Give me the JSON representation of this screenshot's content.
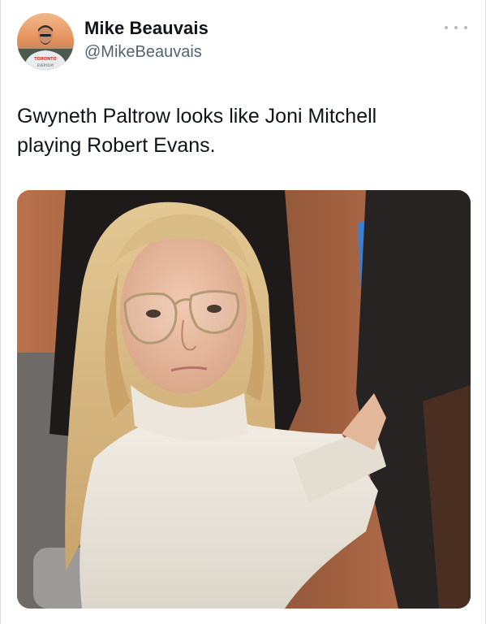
{
  "tweet": {
    "author": {
      "display_name": "Mike Beauvais",
      "handle": "@MikeBeauvais",
      "avatar": {
        "icon": "profile-photo",
        "shirt_text": "TORONTO",
        "shirt_text_2": "EVERYDAY"
      }
    },
    "more_icon": "more-horizontal-icon",
    "text_line_1": "Gwyneth Paltrow looks like Joni Mitchell",
    "text_line_2": "playing Robert Evans.",
    "media": {
      "kind": "photo",
      "description_icon": "photo-woman-with-glasses-courtroom"
    }
  },
  "colors": {
    "text": "#0f1419",
    "secondary": "#536471",
    "dots": "#b4b9be"
  }
}
